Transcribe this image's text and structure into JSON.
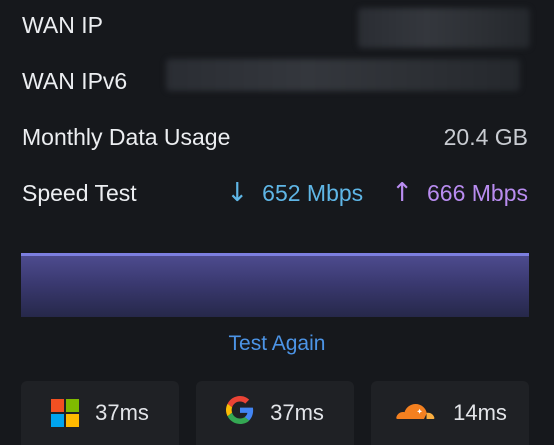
{
  "wan_ip": {
    "label": "WAN IP"
  },
  "wan_ipv6": {
    "label": "WAN IPv6"
  },
  "monthly": {
    "label": "Monthly Data Usage",
    "value": "20.4 GB"
  },
  "speed_test": {
    "label": "Speed Test",
    "download": "652 Mbps",
    "upload": "666 Mbps",
    "download_arrow": "↓",
    "upload_arrow": "↑",
    "download_color": "#5fb6e6",
    "upload_color": "#b98cf0"
  },
  "test_again_label": "Test Again",
  "pings": [
    {
      "icon": "microsoft-icon",
      "value": "37ms"
    },
    {
      "icon": "google-icon",
      "value": "37ms"
    },
    {
      "icon": "cloudflare-icon",
      "value": "14ms"
    }
  ]
}
